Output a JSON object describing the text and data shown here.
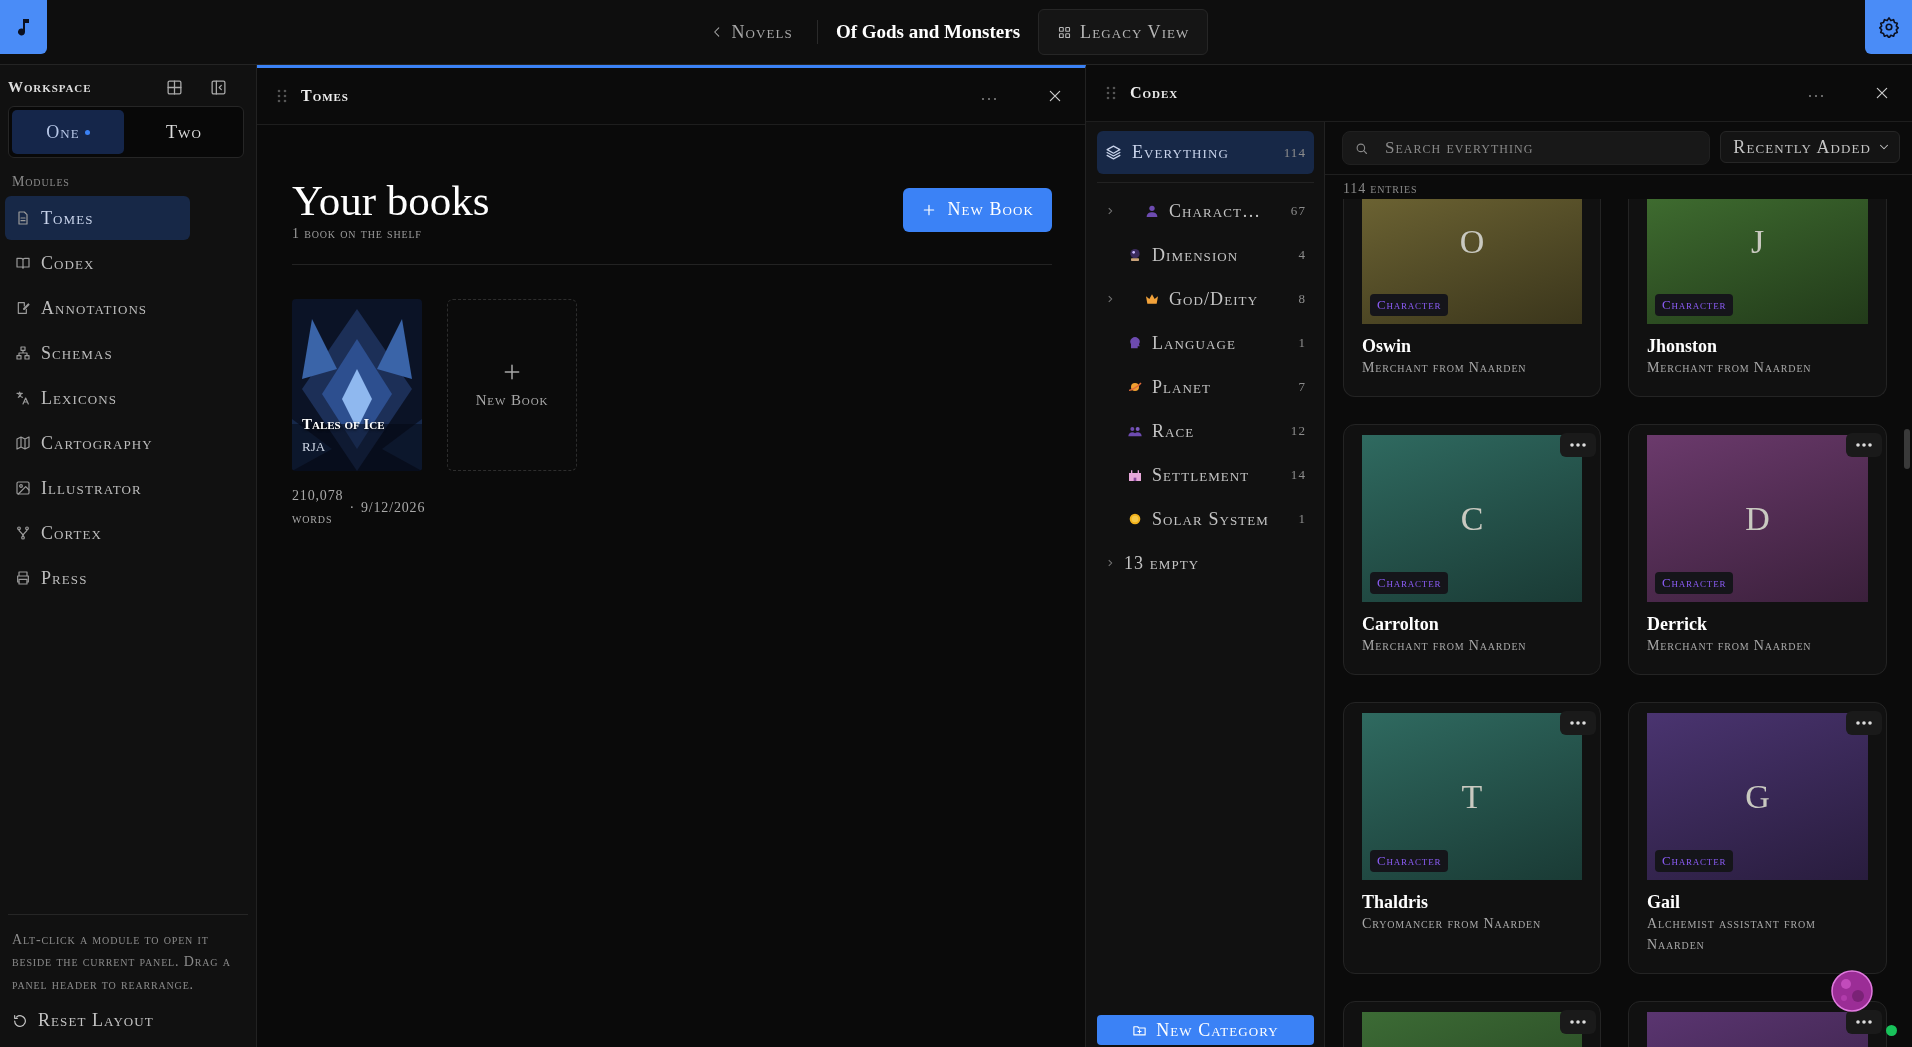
{
  "app_bar": {
    "back_link": "Novels",
    "title": "Of Gods and Monsters",
    "legacy_button": "Legacy View"
  },
  "sidebar": {
    "title": "Workspace",
    "workspaces": [
      {
        "label": "One",
        "selected": true
      },
      {
        "label": "Two",
        "selected": false
      }
    ],
    "section": "Modules",
    "modules": [
      {
        "label": "Tomes",
        "selected": true
      },
      {
        "label": "Codex",
        "selected": false
      },
      {
        "label": "Annotations",
        "selected": false
      },
      {
        "label": "Schemas",
        "selected": false
      },
      {
        "label": "Lexicons",
        "selected": false
      },
      {
        "label": "Cartography",
        "selected": false
      },
      {
        "label": "Illustrator",
        "selected": false
      },
      {
        "label": "Cortex",
        "selected": false
      },
      {
        "label": "Press",
        "selected": false
      }
    ],
    "hint": "Alt-click a module to open it beside the current panel. Drag a panel header to rearrange.",
    "reset": "Reset Layout"
  },
  "tomes": {
    "title": "Tomes",
    "heading": "Your books",
    "subheading": "1 book on the shelf",
    "new_button": "New Book",
    "books": [
      {
        "title": "Tales of Ice",
        "author": "RJA",
        "words": "210,078 words",
        "separator": "·",
        "date": "9/12/2026"
      }
    ],
    "new_tile": "New Book"
  },
  "codex": {
    "title": "Codex",
    "everything": {
      "label": "Everything",
      "count": "114",
      "selected": true
    },
    "categories": [
      {
        "label": "Charact…",
        "count": "67",
        "expanded": false
      },
      {
        "label": "Dimension",
        "count": "4"
      },
      {
        "label": "God/Deity",
        "count": "8",
        "expanded": false
      },
      {
        "label": "Language",
        "count": "1"
      },
      {
        "label": "Planet",
        "count": "7"
      },
      {
        "label": "Race",
        "count": "12"
      },
      {
        "label": "Settlement",
        "count": "14"
      },
      {
        "label": "Solar System",
        "count": "1"
      }
    ],
    "empty_group": {
      "label": "13 empty",
      "expanded": false
    },
    "new_category": "New Category",
    "search": {
      "placeholder": "Search everything"
    },
    "sort": "Recently Added",
    "entries_count": "114 entries",
    "entries": [
      {
        "letter": "O",
        "tag": "Character",
        "name": "Oswin",
        "description": "Merchant from Naarden",
        "color": "#6b6232",
        "kind": "cut"
      },
      {
        "letter": "J",
        "tag": "Character",
        "name": "Jhonston",
        "description": "Merchant from Naarden",
        "color": "#3e6b2f",
        "kind": "cut"
      },
      {
        "letter": "C",
        "tag": "Character",
        "name": "Carrolton",
        "description": "Merchant from Naarden",
        "color": "#2f6a60",
        "kind": "full"
      },
      {
        "letter": "D",
        "tag": "Character",
        "name": "Derrick",
        "description": "Merchant from Naarden",
        "color": "#6b3a6c",
        "kind": "full"
      },
      {
        "letter": "T",
        "tag": "Character",
        "name": "Thaldris",
        "description": "Cryomancer from Naarden",
        "color": "#2f6a60",
        "kind": "full"
      },
      {
        "letter": "G",
        "tag": "Character",
        "name": "Gail",
        "description": "Alchemist assistant from Naarden",
        "color": "#4a3470",
        "kind": "full"
      },
      {
        "color": "#3c6b35",
        "kind": "full"
      },
      {
        "color": "#5a3570",
        "kind": "full"
      }
    ]
  }
}
